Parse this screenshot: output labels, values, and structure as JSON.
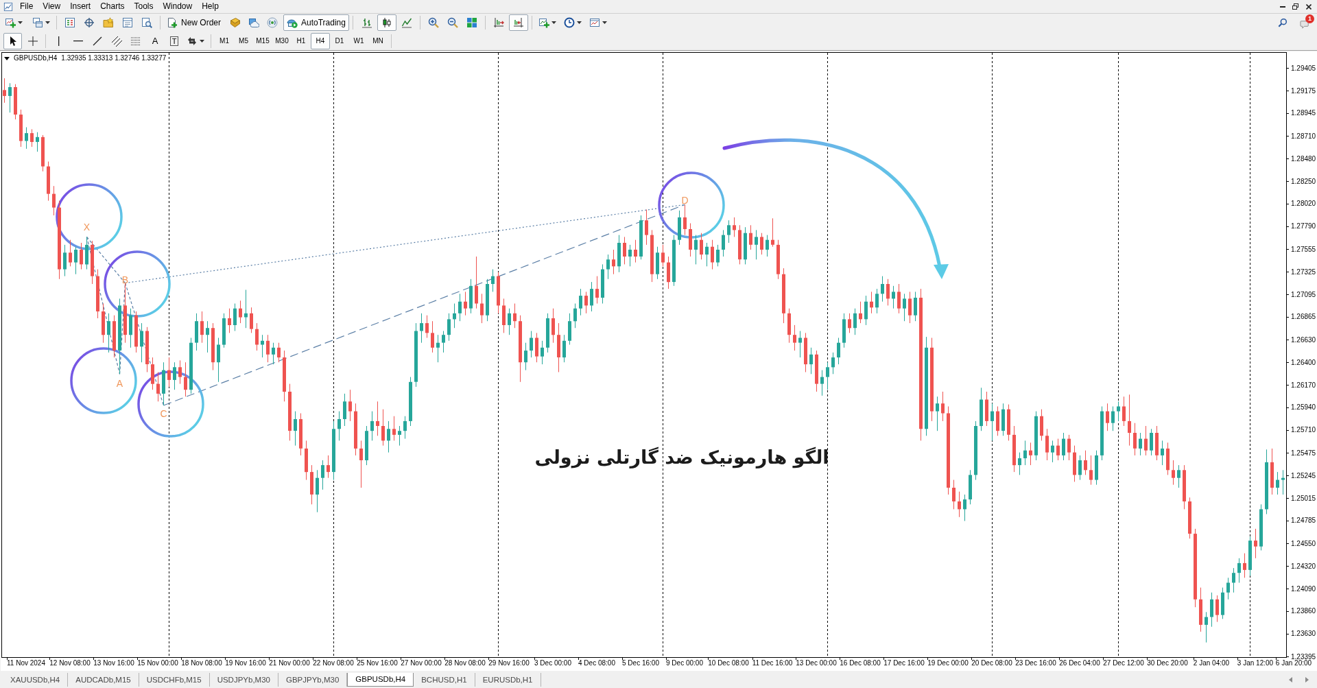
{
  "menu": [
    "File",
    "View",
    "Insert",
    "Charts",
    "Tools",
    "Window",
    "Help"
  ],
  "toolbar": {
    "new_order": "New Order",
    "autotrading": {
      "label": "AutoTrading",
      "on": true
    },
    "chart_types": [
      {
        "selected": false
      },
      {
        "selected": true
      },
      {
        "selected": false
      }
    ],
    "autoscroll": {
      "on": true
    },
    "notifications_badge": "1"
  },
  "drawing_tools": {
    "pointer_tools": [
      {
        "selected": true
      },
      {
        "selected": false
      }
    ],
    "text_tool": "A",
    "label_tool": "T"
  },
  "timeframes": [
    {
      "label": "M1",
      "selected": false
    },
    {
      "label": "M5",
      "selected": false
    },
    {
      "label": "M15",
      "selected": false
    },
    {
      "label": "M30",
      "selected": false
    },
    {
      "label": "H1",
      "selected": false
    },
    {
      "label": "H4",
      "selected": true
    },
    {
      "label": "D1",
      "selected": false
    },
    {
      "label": "W1",
      "selected": false
    },
    {
      "label": "MN",
      "selected": false
    }
  ],
  "chart": {
    "symbol": "GBPUSDb,H4",
    "ohlc_readout": "1.32935 1.33313 1.32746 1.33277",
    "caption": "الگو هارمونیک ضد گارتلی نزولی",
    "chart_data": {
      "type": "candlestick",
      "annotations": [
        "X",
        "A",
        "B",
        "C",
        "D"
      ],
      "ylim": [
        1.2339,
        1.2956
      ],
      "yticks": [
        1.29405,
        1.29175,
        1.28945,
        {
          "value": 1.2871,
          "label": "1.28710"
        },
        {
          "value": 1.2848,
          "label": "1.28480"
        },
        {
          "value": 1.2825,
          "label": "1.28250"
        },
        {
          "value": 1.2802,
          "label": "1.28020"
        },
        {
          "value": 1.2779,
          "label": "1.27790"
        },
        1.27555,
        1.27325,
        1.27095,
        1.26865,
        {
          "value": 1.2663,
          "label": "1.26630"
        },
        {
          "value": 1.264,
          "label": "1.26400"
        },
        {
          "value": 1.2617,
          "label": "1.26170"
        },
        {
          "value": 1.2594,
          "label": "1.25940"
        },
        {
          "value": 1.2571,
          "label": "1.25710"
        },
        1.25475,
        1.25245,
        1.25015,
        1.24785,
        {
          "value": 1.2455,
          "label": "1.24550"
        },
        {
          "value": 1.2432,
          "label": "1.24320"
        },
        {
          "value": 1.2409,
          "label": "1.24090"
        },
        {
          "value": 1.2386,
          "label": "1.23860"
        },
        {
          "value": 1.2363,
          "label": "1.23630"
        },
        1.23395
      ],
      "categories": [
        null,
        null,
        null,
        null,
        "11 Nov 2024",
        null,
        null,
        null,
        null,
        null,
        null,
        null,
        "12 Nov 08:00",
        null,
        null,
        null,
        null,
        null,
        null,
        null,
        "13 Nov 16:00",
        null,
        null,
        null,
        null,
        null,
        null,
        null,
        "15 Nov 00:00",
        null,
        null,
        null,
        null,
        null,
        null,
        null,
        "18 Nov 08:00",
        null,
        null,
        null,
        null,
        null,
        null,
        null,
        "19 Nov 16:00",
        null,
        null,
        null,
        null,
        null,
        null,
        null,
        "21 Nov 00:00",
        null,
        null,
        null,
        null,
        null,
        null,
        null,
        "22 Nov 08:00",
        null,
        null,
        null,
        null,
        null,
        null,
        null,
        "25 Nov 16:00",
        null,
        null,
        null,
        null,
        null,
        null,
        null,
        "27 Nov 00:00",
        null,
        null,
        null,
        null,
        null,
        null,
        null,
        "28 Nov 08:00",
        null,
        null,
        null,
        null,
        null,
        null,
        null,
        "29 Nov 16:00",
        null,
        null,
        null,
        null,
        null,
        null,
        null,
        "3 Dec 00:00",
        null,
        null,
        null,
        null,
        null,
        null,
        null,
        "4 Dec 08:00",
        null,
        null,
        null,
        null,
        null,
        null,
        null,
        "5 Dec 16:00",
        null,
        null,
        null,
        null,
        null,
        null,
        null,
        "9 Dec 00:00",
        null,
        null,
        null,
        null,
        null,
        null,
        null,
        "10 Dec 08:00",
        null,
        null,
        null,
        null,
        null,
        null,
        null,
        "11 Dec 16:00",
        null,
        null,
        null,
        null,
        null,
        null,
        null,
        "13 Dec 00:00",
        null,
        null,
        null,
        null,
        null,
        null,
        null,
        "16 Dec 08:00",
        null,
        null,
        null,
        null,
        null,
        null,
        null,
        "17 Dec 16:00",
        null,
        null,
        null,
        null,
        null,
        null,
        null,
        "19 Dec 00:00",
        null,
        null,
        null,
        null,
        null,
        null,
        null,
        "20 Dec 08:00",
        null,
        null,
        null,
        null,
        null,
        null,
        null,
        "23 Dec 16:00",
        null,
        null,
        null,
        null,
        null,
        null,
        null,
        "26 Dec 04:00",
        null,
        null,
        null,
        null,
        null,
        null,
        null,
        "27 Dec 12:00",
        null,
        null,
        null,
        null,
        null,
        null,
        null,
        "30 Dec 20:00",
        null,
        null,
        null,
        null,
        null,
        null,
        null,
        "2 Jan 04:00",
        null,
        null,
        null,
        null,
        null,
        null,
        null,
        "3 Jan 12:00",
        null,
        null,
        null,
        null,
        null,
        null,
        "6 Jan 20:00"
      ],
      "ohlc": [
        [
          1.2918,
          1.293,
          1.2905,
          1.2912
        ],
        [
          1.2912,
          1.2925,
          1.2895,
          1.2921
        ],
        [
          1.2921,
          1.2924,
          1.2888,
          1.2893
        ],
        [
          1.2893,
          1.2898,
          1.286,
          1.2866
        ],
        [
          1.2866,
          1.288,
          1.2858,
          1.2874
        ],
        [
          1.2874,
          1.2878,
          1.286,
          1.2865
        ],
        [
          1.2865,
          1.2875,
          1.2855,
          1.287
        ],
        [
          1.287,
          1.2872,
          1.2835,
          1.284
        ],
        [
          1.284,
          1.2845,
          1.2805,
          1.2812
        ],
        [
          1.2812,
          1.282,
          1.279,
          1.2798
        ],
        [
          1.2798,
          1.2805,
          1.2725,
          1.2735
        ],
        [
          1.2735,
          1.276,
          1.2728,
          1.2752
        ],
        [
          1.2752,
          1.2765,
          1.2738,
          1.2742
        ],
        [
          1.2742,
          1.2758,
          1.273,
          1.2755
        ],
        [
          1.2755,
          1.2762,
          1.2735,
          1.274
        ],
        [
          1.274,
          1.2768,
          1.2735,
          1.276
        ],
        [
          1.276,
          1.2764,
          1.272,
          1.2728
        ],
        [
          1.2728,
          1.2735,
          1.2685,
          1.2692
        ],
        [
          1.2692,
          1.27,
          1.266,
          1.2668
        ],
        [
          1.2668,
          1.269,
          1.265,
          1.2682
        ],
        [
          1.2682,
          1.2688,
          1.2645,
          1.2652
        ],
        [
          1.2652,
          1.2705,
          1.2628,
          1.2698
        ],
        [
          1.2698,
          1.2721,
          1.266,
          1.2668
        ],
        [
          1.2668,
          1.2695,
          1.2655,
          1.2688
        ],
        [
          1.2688,
          1.2692,
          1.265,
          1.2656
        ],
        [
          1.2656,
          1.268,
          1.264,
          1.2672
        ],
        [
          1.2672,
          1.2676,
          1.263,
          1.2638
        ],
        [
          1.2638,
          1.2645,
          1.2612,
          1.2618
        ],
        [
          1.2618,
          1.263,
          1.26,
          1.2608
        ],
        [
          1.2608,
          1.264,
          1.2596,
          1.2632
        ],
        [
          1.2632,
          1.2645,
          1.2615,
          1.2622
        ],
        [
          1.2622,
          1.264,
          1.2612,
          1.2635
        ],
        [
          1.2635,
          1.2642,
          1.2618,
          1.2625
        ],
        [
          1.2625,
          1.264,
          1.2605,
          1.2612
        ],
        [
          1.2612,
          1.2665,
          1.2608,
          1.266
        ],
        [
          1.266,
          1.269,
          1.2652,
          1.2682
        ],
        [
          1.2682,
          1.2692,
          1.266,
          1.2668
        ],
        [
          1.2668,
          1.2682,
          1.265,
          1.2675
        ],
        [
          1.2675,
          1.268,
          1.2632,
          1.264
        ],
        [
          1.264,
          1.2665,
          1.262,
          1.2658
        ],
        [
          1.2658,
          1.269,
          1.2655,
          1.2685
        ],
        [
          1.2685,
          1.2695,
          1.267,
          1.2678
        ],
        [
          1.2678,
          1.27,
          1.2672,
          1.2695
        ],
        [
          1.2695,
          1.2703,
          1.268,
          1.2686
        ],
        [
          1.2686,
          1.2714,
          1.2675,
          1.269
        ],
        [
          1.269,
          1.2696,
          1.267,
          1.2674
        ],
        [
          1.2674,
          1.268,
          1.2652,
          1.2658
        ],
        [
          1.2658,
          1.2668,
          1.2645,
          1.2662
        ],
        [
          1.2662,
          1.2668,
          1.264,
          1.2648
        ],
        [
          1.2648,
          1.266,
          1.2638,
          1.2655
        ],
        [
          1.2655,
          1.266,
          1.264,
          1.2645
        ],
        [
          1.2645,
          1.2652,
          1.26,
          1.261
        ],
        [
          1.261,
          1.2618,
          1.256,
          1.257
        ],
        [
          1.257,
          1.259,
          1.2555,
          1.2582
        ],
        [
          1.2582,
          1.2588,
          1.2545,
          1.2552
        ],
        [
          1.2552,
          1.256,
          1.252,
          1.2528
        ],
        [
          1.2528,
          1.2535,
          1.2495,
          1.2505
        ],
        [
          1.2505,
          1.253,
          1.2487,
          1.2522
        ],
        [
          1.2522,
          1.254,
          1.251,
          1.2535
        ],
        [
          1.2535,
          1.2545,
          1.2522,
          1.2528
        ],
        [
          1.2528,
          1.258,
          1.252,
          1.2572
        ],
        [
          1.2572,
          1.259,
          1.256,
          1.2582
        ],
        [
          1.2582,
          1.2608,
          1.2575,
          1.26
        ],
        [
          1.26,
          1.2612,
          1.258,
          1.259
        ],
        [
          1.259,
          1.2598,
          1.2545,
          1.2552
        ],
        [
          1.2552,
          1.256,
          1.2512,
          1.254
        ],
        [
          1.254,
          1.2575,
          1.2535,
          1.257
        ],
        [
          1.257,
          1.259,
          1.256,
          1.258
        ],
        [
          1.258,
          1.26,
          1.2565,
          1.2575
        ],
        [
          1.2575,
          1.2592,
          1.2555,
          1.256
        ],
        [
          1.256,
          1.258,
          1.2548,
          1.2572
        ],
        [
          1.2572,
          1.2585,
          1.256,
          1.2566
        ],
        [
          1.2566,
          1.2575,
          1.2555,
          1.257
        ],
        [
          1.257,
          1.2585,
          1.2562,
          1.258
        ],
        [
          1.258,
          1.2625,
          1.2575,
          1.262
        ],
        [
          1.262,
          1.268,
          1.2615,
          1.2672
        ],
        [
          1.2672,
          1.269,
          1.266,
          1.268
        ],
        [
          1.268,
          1.2688,
          1.2665,
          1.267
        ],
        [
          1.267,
          1.2682,
          1.265,
          1.2655
        ],
        [
          1.2655,
          1.2668,
          1.264,
          1.266
        ],
        [
          1.266,
          1.2672,
          1.265,
          1.2668
        ],
        [
          1.2668,
          1.269,
          1.2662,
          1.2684
        ],
        [
          1.2684,
          1.27,
          1.2675,
          1.269
        ],
        [
          1.269,
          1.271,
          1.2682,
          1.2702
        ],
        [
          1.2702,
          1.2712,
          1.2688,
          1.2695
        ],
        [
          1.2695,
          1.2725,
          1.269,
          1.2718
        ],
        [
          1.2718,
          1.2748,
          1.2695,
          1.27
        ],
        [
          1.27,
          1.271,
          1.268,
          1.2688
        ],
        [
          1.2688,
          1.2725,
          1.2682,
          1.272
        ],
        [
          1.272,
          1.2735,
          1.2712,
          1.2728
        ],
        [
          1.2728,
          1.2732,
          1.269,
          1.2698
        ],
        [
          1.2698,
          1.2705,
          1.267,
          1.2678
        ],
        [
          1.2678,
          1.2695,
          1.2668,
          1.269
        ],
        [
          1.269,
          1.27,
          1.2675,
          1.2682
        ],
        [
          1.2682,
          1.2688,
          1.262,
          1.264
        ],
        [
          1.264,
          1.266,
          1.2632,
          1.2652
        ],
        [
          1.2652,
          1.2672,
          1.2645,
          1.2665
        ],
        [
          1.2665,
          1.267,
          1.264,
          1.2646
        ],
        [
          1.2646,
          1.2662,
          1.2638,
          1.2655
        ],
        [
          1.2655,
          1.269,
          1.265,
          1.2685
        ],
        [
          1.2685,
          1.2695,
          1.266,
          1.2668
        ],
        [
          1.2668,
          1.268,
          1.263,
          1.2645
        ],
        [
          1.2645,
          1.2668,
          1.264,
          1.2662
        ],
        [
          1.2662,
          1.269,
          1.2658,
          1.2682
        ],
        [
          1.2682,
          1.27,
          1.2675,
          1.2695
        ],
        [
          1.2695,
          1.2715,
          1.2688,
          1.2708
        ],
        [
          1.2708,
          1.2712,
          1.269,
          1.2698
        ],
        [
          1.2698,
          1.2722,
          1.2692,
          1.2715
        ],
        [
          1.2715,
          1.2728,
          1.27,
          1.2706
        ],
        [
          1.2706,
          1.274,
          1.27,
          1.2735
        ],
        [
          1.2735,
          1.275,
          1.2725,
          1.2745
        ],
        [
          1.2745,
          1.2755,
          1.273,
          1.2738
        ],
        [
          1.2738,
          1.277,
          1.2732,
          1.2762
        ],
        [
          1.2762,
          1.2768,
          1.274,
          1.2748
        ],
        [
          1.2748,
          1.276,
          1.2738,
          1.2755
        ],
        [
          1.2755,
          1.2765,
          1.2742,
          1.2748
        ],
        [
          1.2748,
          1.279,
          1.2745,
          1.2785
        ],
        [
          1.2785,
          1.2796,
          1.276,
          1.277
        ],
        [
          1.277,
          1.2775,
          1.2722,
          1.273
        ],
        [
          1.273,
          1.2758,
          1.2725,
          1.2752
        ],
        [
          1.2752,
          1.276,
          1.2738,
          1.2742
        ],
        [
          1.2742,
          1.2748,
          1.2715,
          1.2722
        ],
        [
          1.2722,
          1.277,
          1.2718,
          1.2765
        ],
        [
          1.2765,
          1.2795,
          1.276,
          1.2788
        ],
        [
          1.2788,
          1.2801,
          1.277,
          1.2776
        ],
        [
          1.2776,
          1.2782,
          1.2748,
          1.2755
        ],
        [
          1.2755,
          1.277,
          1.274,
          1.2765
        ],
        [
          1.2765,
          1.2772,
          1.2745,
          1.275
        ],
        [
          1.275,
          1.2762,
          1.2738,
          1.2758
        ],
        [
          1.2758,
          1.2765,
          1.2735,
          1.2742
        ],
        [
          1.2742,
          1.276,
          1.2738,
          1.2755
        ],
        [
          1.2755,
          1.2775,
          1.2748,
          1.277
        ],
        [
          1.277,
          1.2785,
          1.2762,
          1.278
        ],
        [
          1.278,
          1.2788,
          1.2768,
          1.2775
        ],
        [
          1.2775,
          1.278,
          1.274,
          1.2745
        ],
        [
          1.2745,
          1.2778,
          1.274,
          1.2772
        ],
        [
          1.2772,
          1.278,
          1.2755,
          1.276
        ],
        [
          1.276,
          1.2775,
          1.2745,
          1.2768
        ],
        [
          1.2768,
          1.2772,
          1.275,
          1.2755
        ],
        [
          1.2755,
          1.277,
          1.2748,
          1.2765
        ],
        [
          1.2765,
          1.2787,
          1.2758,
          1.276
        ],
        [
          1.276,
          1.2765,
          1.2725,
          1.273
        ],
        [
          1.273,
          1.2736,
          1.268,
          1.269
        ],
        [
          1.269,
          1.2695,
          1.266,
          1.2668
        ],
        [
          1.2668,
          1.2678,
          1.2652,
          1.266
        ],
        [
          1.266,
          1.2672,
          1.2645,
          1.2665
        ],
        [
          1.2665,
          1.267,
          1.263,
          1.2638
        ],
        [
          1.2638,
          1.2655,
          1.2628,
          1.2648
        ],
        [
          1.2648,
          1.2652,
          1.261,
          1.2618
        ],
        [
          1.2618,
          1.2632,
          1.2606,
          1.2625
        ],
        [
          1.2625,
          1.264,
          1.2612,
          1.2635
        ],
        [
          1.2635,
          1.265,
          1.2628,
          1.2645
        ],
        [
          1.2645,
          1.2665,
          1.2638,
          1.266
        ],
        [
          1.266,
          1.269,
          1.2655,
          1.2684
        ],
        [
          1.2684,
          1.269,
          1.267,
          1.2675
        ],
        [
          1.2675,
          1.2695,
          1.2668,
          1.269
        ],
        [
          1.269,
          1.2702,
          1.268,
          1.2684
        ],
        [
          1.2684,
          1.2708,
          1.2678,
          1.2702
        ],
        [
          1.2702,
          1.2712,
          1.269,
          1.2696
        ],
        [
          1.2696,
          1.2715,
          1.269,
          1.271
        ],
        [
          1.271,
          1.2728,
          1.2702,
          1.272
        ],
        [
          1.272,
          1.2725,
          1.2698,
          1.2705
        ],
        [
          1.2705,
          1.2718,
          1.2695,
          1.2712
        ],
        [
          1.2712,
          1.272,
          1.269,
          1.2695
        ],
        [
          1.2695,
          1.271,
          1.2682,
          1.2705
        ],
        [
          1.2705,
          1.2712,
          1.268,
          1.2688
        ],
        [
          1.2688,
          1.2712,
          1.2682,
          1.2706
        ],
        [
          1.2706,
          1.2715,
          1.256,
          1.2572
        ],
        [
          1.2572,
          1.2666,
          1.2565,
          1.2655
        ],
        [
          1.2655,
          1.2665,
          1.258,
          1.259
        ],
        [
          1.259,
          1.2605,
          1.257,
          1.2598
        ],
        [
          1.2598,
          1.261,
          1.258,
          1.2588
        ],
        [
          1.2588,
          1.2595,
          1.2505,
          1.2512
        ],
        [
          1.2512,
          1.252,
          1.249,
          1.2498
        ],
        [
          1.2498,
          1.2508,
          1.2482,
          1.249
        ],
        [
          1.249,
          1.2505,
          1.2478,
          1.25
        ],
        [
          1.25,
          1.253,
          1.2495,
          1.2525
        ],
        [
          1.2525,
          1.258,
          1.252,
          1.2575
        ],
        [
          1.2575,
          1.2614,
          1.257,
          1.2602
        ],
        [
          1.2602,
          1.261,
          1.2575,
          1.258
        ],
        [
          1.258,
          1.2598,
          1.256,
          1.259
        ],
        [
          1.259,
          1.2595,
          1.2565,
          1.257
        ],
        [
          1.257,
          1.2598,
          1.2565,
          1.2592
        ],
        [
          1.2592,
          1.2597,
          1.256,
          1.2566
        ],
        [
          1.2566,
          1.2575,
          1.2528,
          1.2535
        ],
        [
          1.2535,
          1.2548,
          1.2525,
          1.2542
        ],
        [
          1.2542,
          1.256,
          1.2535,
          1.255
        ],
        [
          1.255,
          1.2558,
          1.2535,
          1.2545
        ],
        [
          1.2545,
          1.259,
          1.254,
          1.2585
        ],
        [
          1.2585,
          1.2592,
          1.256,
          1.2565
        ],
        [
          1.2565,
          1.2572,
          1.254,
          1.2548
        ],
        [
          1.2548,
          1.256,
          1.2538,
          1.2555
        ],
        [
          1.2555,
          1.2562,
          1.254,
          1.2545
        ],
        [
          1.2545,
          1.2568,
          1.254,
          1.2562
        ],
        [
          1.2562,
          1.2566,
          1.254,
          1.2548
        ],
        [
          1.2548,
          1.2555,
          1.2518,
          1.2525
        ],
        [
          1.2525,
          1.2545,
          1.252,
          1.254
        ],
        [
          1.254,
          1.255,
          1.2525,
          1.253
        ],
        [
          1.253,
          1.2545,
          1.2515,
          1.252
        ],
        [
          1.252,
          1.255,
          1.2515,
          1.2545
        ],
        [
          1.2545,
          1.2595,
          1.254,
          1.259
        ],
        [
          1.259,
          1.2598,
          1.257,
          1.2578
        ],
        [
          1.2578,
          1.2595,
          1.257,
          1.259
        ],
        [
          1.259,
          1.26,
          1.258,
          1.2595
        ],
        [
          1.2595,
          1.2605,
          1.2575,
          1.258
        ],
        [
          1.258,
          1.2607,
          1.2555,
          1.2568
        ],
        [
          1.2568,
          1.2578,
          1.2545,
          1.2552
        ],
        [
          1.2552,
          1.2568,
          1.2545,
          1.2562
        ],
        [
          1.2562,
          1.2575,
          1.2545,
          1.255
        ],
        [
          1.255,
          1.2572,
          1.2545,
          1.2568
        ],
        [
          1.2568,
          1.2575,
          1.254,
          1.2545
        ],
        [
          1.2545,
          1.256,
          1.2535,
          1.2552
        ],
        [
          1.2552,
          1.2558,
          1.2525,
          1.253
        ],
        [
          1.253,
          1.254,
          1.2515,
          1.2522
        ],
        [
          1.2522,
          1.2535,
          1.2512,
          1.253
        ],
        [
          1.253,
          1.2535,
          1.249,
          1.2498
        ],
        [
          1.2498,
          1.2502,
          1.246,
          1.2465
        ],
        [
          1.2465,
          1.247,
          1.239,
          1.2398
        ],
        [
          1.2398,
          1.241,
          1.2365,
          1.2372
        ],
        [
          1.2372,
          1.2385,
          1.2354,
          1.238
        ],
        [
          1.238,
          1.2405,
          1.237,
          1.2398
        ],
        [
          1.2398,
          1.2402,
          1.2375,
          1.2382
        ],
        [
          1.2382,
          1.241,
          1.2378,
          1.2405
        ],
        [
          1.2405,
          1.242,
          1.2398,
          1.2415
        ],
        [
          1.2415,
          1.243,
          1.2405,
          1.2425
        ],
        [
          1.2425,
          1.244,
          1.2415,
          1.2435
        ],
        [
          1.2435,
          1.2445,
          1.242,
          1.2428
        ],
        [
          1.2428,
          1.2462,
          1.2422,
          1.2458
        ],
        [
          1.2458,
          1.247,
          1.244,
          1.2452
        ],
        [
          1.2452,
          1.2495,
          1.2448,
          1.249
        ],
        [
          1.249,
          1.2551,
          1.2485,
          1.2538
        ],
        [
          1.2538,
          1.2552,
          1.2505,
          1.2512
        ],
        [
          1.2512,
          1.2528,
          1.2505,
          1.252
        ],
        [
          1.252,
          1.253,
          1.2505,
          1.2522
        ],
        null,
        null
      ]
    }
  },
  "tabs": [
    {
      "label": "XAUUSDb,H4",
      "selected": false
    },
    {
      "label": "AUDCADb,M15",
      "selected": false
    },
    {
      "label": "USDCHFb,M15",
      "selected": false
    },
    {
      "label": "USDJPYb,M30",
      "selected": false
    },
    {
      "label": "GBPJPYb,M30",
      "selected": false
    },
    {
      "label": "GBPUSDb,H4",
      "selected": true
    },
    {
      "label": "BCHUSD,H1",
      "selected": false
    },
    {
      "label": "EURUSDb,H1",
      "selected": false
    }
  ]
}
